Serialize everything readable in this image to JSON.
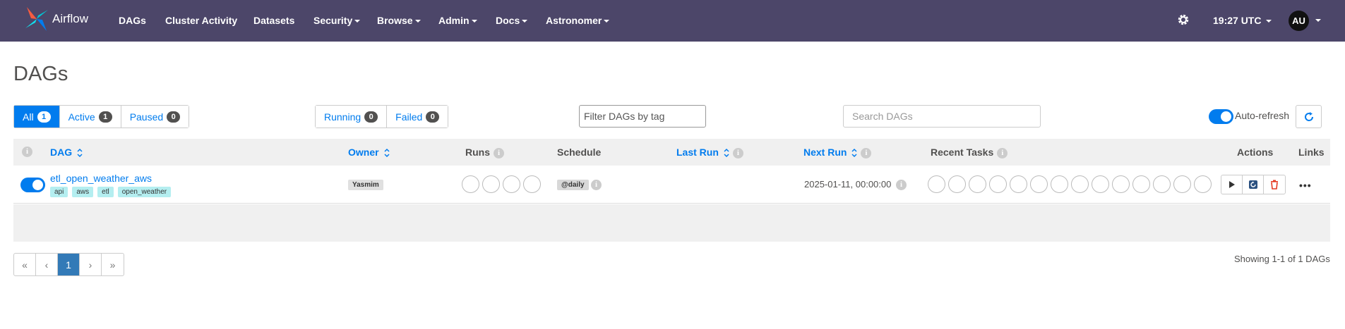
{
  "nav": {
    "brand": "Airflow",
    "items": [
      {
        "label": "DAGs",
        "dropdown": false
      },
      {
        "label": "Cluster Activity",
        "dropdown": false
      },
      {
        "label": "Datasets",
        "dropdown": false
      },
      {
        "label": "Security",
        "dropdown": true
      },
      {
        "label": "Browse",
        "dropdown": true
      },
      {
        "label": "Admin",
        "dropdown": true
      },
      {
        "label": "Docs",
        "dropdown": true
      },
      {
        "label": "Astronomer",
        "dropdown": true
      }
    ],
    "time": "19:27 UTC",
    "user_initials": "AU"
  },
  "page": {
    "title": "DAGs"
  },
  "status_filters": [
    {
      "label": "All",
      "count": "1",
      "active": true
    },
    {
      "label": "Active",
      "count": "1",
      "active": false
    },
    {
      "label": "Paused",
      "count": "0",
      "active": false
    }
  ],
  "run_filters": [
    {
      "label": "Running",
      "count": "0"
    },
    {
      "label": "Failed",
      "count": "0"
    }
  ],
  "tag_filter": {
    "placeholder": "Filter DAGs by tag"
  },
  "search": {
    "placeholder": "Search DAGs"
  },
  "auto_refresh": {
    "label": "Auto-refresh",
    "enabled": true
  },
  "table": {
    "columns": {
      "dag": "DAG",
      "owner": "Owner",
      "runs": "Runs",
      "schedule": "Schedule",
      "last_run": "Last Run",
      "next_run": "Next Run",
      "recent_tasks": "Recent Tasks",
      "actions": "Actions",
      "links": "Links"
    },
    "rows": [
      {
        "paused": false,
        "dag_id": "etl_open_weather_aws",
        "tags": [
          "api",
          "aws",
          "etl",
          "open_weather"
        ],
        "owner": "Yasmim",
        "schedule": "@daily",
        "last_run": "",
        "next_run": "2025-01-11, 00:00:00"
      }
    ]
  },
  "pagination": {
    "first": "«",
    "prev": "‹",
    "current": "1",
    "next": "›",
    "last": "»",
    "summary": "Showing 1-1 of 1 DAGs"
  },
  "colors": {
    "navbar": "#4c4669",
    "primary": "#017cee",
    "tag": "#b4eef0",
    "delete": "#e43921"
  }
}
